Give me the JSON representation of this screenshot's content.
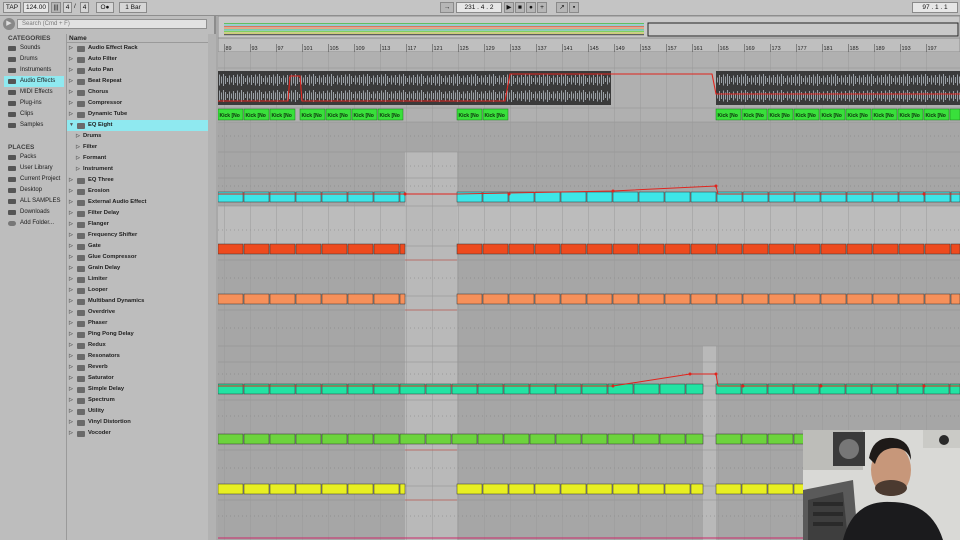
{
  "transport": {
    "tap": "TAP",
    "tempo": "124.00",
    "meter_icon": "metronome-icon",
    "sig_num": "4",
    "sig_slash": "/",
    "sig_den": "4",
    "rec_mode": "O●",
    "quant": "1 Bar",
    "follow": "→",
    "position": "231 .   4 .   2",
    "play_icon": "play-icon",
    "stop_icon": "stop-icon",
    "record_icon": "record-icon",
    "add_icon": "plus-icon",
    "loop_pos": "97 .   1 .   1"
  },
  "browser": {
    "search_placeholder": "Search (Cmd + F)",
    "categories_header": "CATEGORIES",
    "categories": [
      {
        "label": "Sounds",
        "icon": "sounds-icon",
        "selected": false
      },
      {
        "label": "Drums",
        "icon": "drums-icon",
        "selected": false
      },
      {
        "label": "Instruments",
        "icon": "instruments-icon",
        "selected": false
      },
      {
        "label": "Audio Effects",
        "icon": "audio-effects-icon",
        "selected": true
      },
      {
        "label": "MIDI Effects",
        "icon": "midi-effects-icon",
        "selected": false
      },
      {
        "label": "Plug-ins",
        "icon": "plugins-icon",
        "selected": false
      },
      {
        "label": "Clips",
        "icon": "clips-icon",
        "selected": false
      },
      {
        "label": "Samples",
        "icon": "samples-icon",
        "selected": false
      }
    ],
    "places_header": "PLACES",
    "places": [
      {
        "label": "Packs"
      },
      {
        "label": "User Library"
      },
      {
        "label": "Current Project"
      },
      {
        "label": "Desktop"
      },
      {
        "label": "ALL SAMPLES"
      },
      {
        "label": "Downloads"
      },
      {
        "label": "Add Folder..."
      }
    ],
    "name_header": "Name",
    "items": [
      {
        "label": "Audio Effect Rack"
      },
      {
        "label": "Auto Filter"
      },
      {
        "label": "Auto Pan"
      },
      {
        "label": "Beat Repeat"
      },
      {
        "label": "Chorus"
      },
      {
        "label": "Compressor"
      },
      {
        "label": "Dynamic Tube"
      },
      {
        "label": "EQ Eight",
        "selected": true,
        "expanded": true
      },
      {
        "label": "Drums",
        "sub": true
      },
      {
        "label": "Filter",
        "sub": true
      },
      {
        "label": "Formant",
        "sub": true
      },
      {
        "label": "Instrument",
        "sub": true
      },
      {
        "label": "EQ Three"
      },
      {
        "label": "Erosion"
      },
      {
        "label": "External Audio Effect"
      },
      {
        "label": "Filter Delay"
      },
      {
        "label": "Flanger"
      },
      {
        "label": "Frequency Shifter"
      },
      {
        "label": "Gate"
      },
      {
        "label": "Glue Compressor"
      },
      {
        "label": "Grain Delay"
      },
      {
        "label": "Limiter"
      },
      {
        "label": "Looper"
      },
      {
        "label": "Multiband Dynamics"
      },
      {
        "label": "Overdrive"
      },
      {
        "label": "Phaser"
      },
      {
        "label": "Ping Pong Delay"
      },
      {
        "label": "Redux"
      },
      {
        "label": "Resonators"
      },
      {
        "label": "Reverb"
      },
      {
        "label": "Saturator"
      },
      {
        "label": "Simple Delay"
      },
      {
        "label": "Spectrum"
      },
      {
        "label": "Utility"
      },
      {
        "label": "Vinyl Distortion"
      },
      {
        "label": "Vocoder"
      }
    ]
  },
  "arrangement": {
    "bar_numbers": [
      "89",
      "93",
      "97",
      "101",
      "105",
      "109",
      "113",
      "117",
      "121",
      "125",
      "129",
      "133",
      "137",
      "141",
      "145",
      "149",
      "153",
      "157",
      "161",
      "165",
      "169",
      "173",
      "177",
      "181",
      "185",
      "189",
      "193",
      "197"
    ],
    "clip_label": "Kick [No",
    "lanes": [
      {
        "name": "audio-lane",
        "color": "#2a2a2a"
      },
      {
        "name": "kick-lane",
        "color": "#39e03b"
      },
      {
        "name": "cyan-lane",
        "color": "#3de6e8"
      },
      {
        "name": "red-lane",
        "color": "#ee4a1e"
      },
      {
        "name": "orange-lane",
        "color": "#f6905a"
      },
      {
        "name": "teal-lane",
        "color": "#22e3a3"
      },
      {
        "name": "lime-lane",
        "color": "#6cd33d"
      },
      {
        "name": "yellow-lane",
        "color": "#e8ef22"
      }
    ],
    "automation_color": "#e1241d"
  },
  "webcam": {
    "description_icon": "presenter-video-icon"
  }
}
